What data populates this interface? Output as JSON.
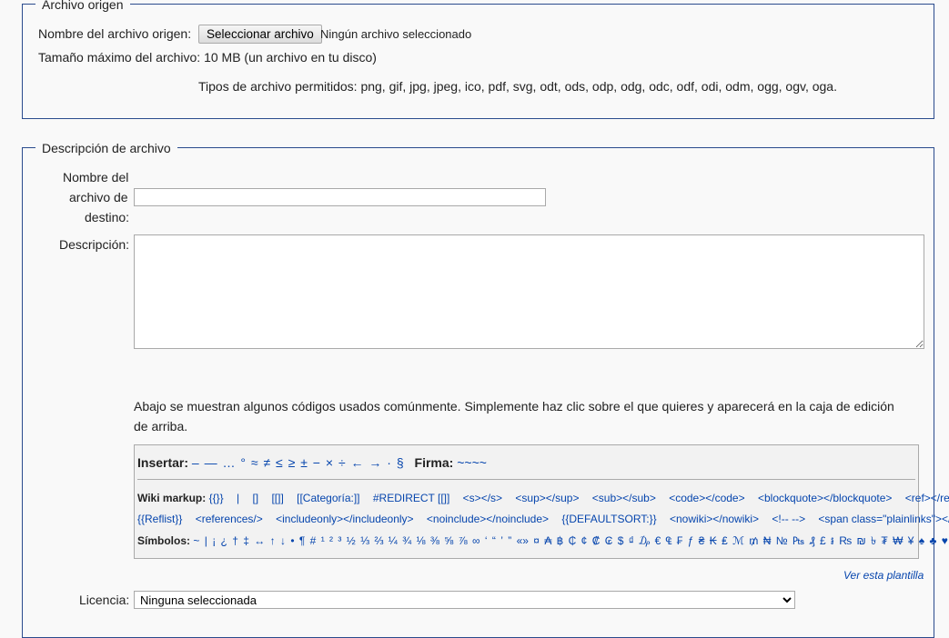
{
  "source": {
    "legend": "Archivo origen",
    "file_label": "Nombre del archivo origen:",
    "choose_button": "Seleccionar archivo",
    "no_file": "Ningún archivo seleccionado",
    "max_size": "Tamaño máximo del archivo: 10 MB (un archivo en tu disco)",
    "allowed_types": "Tipos de archivo permitidos: png, gif, jpg, jpeg, ico, pdf, svg, odt, ods, odp, odg, odc, odf, odi, odm, ogg, ogv, oga."
  },
  "description": {
    "legend": "Descripción de archivo",
    "dest_label_1": "Nombre del",
    "dest_label_2": "archivo de",
    "dest_label_3": "destino:",
    "dest_value": "",
    "desc_label": "Descripción:",
    "desc_value": "",
    "help_line_1": "Abajo se muestran algunos códigos usados comúnmente. Simplemente haz clic sobre el que quieres y aparecerá en la caja de edición",
    "help_line_2": "de arriba."
  },
  "toolbox": {
    "insert_label": "Insertar:",
    "insert_items": [
      "–",
      "—",
      "…",
      "°",
      "≈",
      "≠",
      "≤",
      "≥",
      "±",
      "−",
      "×",
      "÷",
      "←",
      "→",
      "·",
      "§"
    ],
    "signature_label": "Firma:",
    "signature_value": "~~~~",
    "wiki_label": "Wiki markup:",
    "wiki_items_1": [
      "{{}}",
      "|",
      "[]",
      "[[]]",
      "[[Categoría:]]",
      "#REDIRECT [[]]",
      "<s></s>",
      "<sup></sup>",
      "<sub></sub>",
      "<code></code>",
      "<blockquote></blockquote>",
      "<ref></ref>"
    ],
    "wiki_items_2": [
      "{{Reflist}}",
      "<references/>",
      "<includeonly></includeonly>",
      "<noinclude></noinclude>",
      "{{DEFAULTSORT:}}",
      "<nowiki></nowiki>",
      "<!-- -->",
      "<span class=\"plainlinks\"></span>"
    ],
    "symbols_label": "Símbolos:",
    "symbols_items": [
      "~",
      "|",
      "¡",
      "¿",
      "†",
      "‡",
      "↔",
      "↑",
      "↓",
      "•",
      "¶",
      "#",
      "¹",
      "²",
      "³",
      "½",
      "⅓",
      "⅔",
      "¼",
      "¾",
      "⅛",
      "⅜",
      "⅝",
      "⅞",
      "∞",
      "‘",
      "“",
      "’",
      "”",
      "«»",
      "¤",
      "₳",
      "฿",
      "₵",
      "¢",
      "₡",
      "₢",
      "$",
      "₫",
      "₯",
      "€",
      "₠",
      "₣",
      "ƒ",
      "₴",
      "₭",
      "₤",
      "ℳ",
      "₥",
      "₦",
      "№",
      "₧",
      "₰",
      "£",
      "៛",
      "₨",
      "₪",
      "৳",
      "₮",
      "₩",
      "¥",
      "♠",
      "♣",
      "♥",
      "♦"
    ]
  },
  "template_link": "Ver esta plantilla",
  "license": {
    "label": "Licencia:",
    "selected": "Ninguna seleccionada"
  }
}
